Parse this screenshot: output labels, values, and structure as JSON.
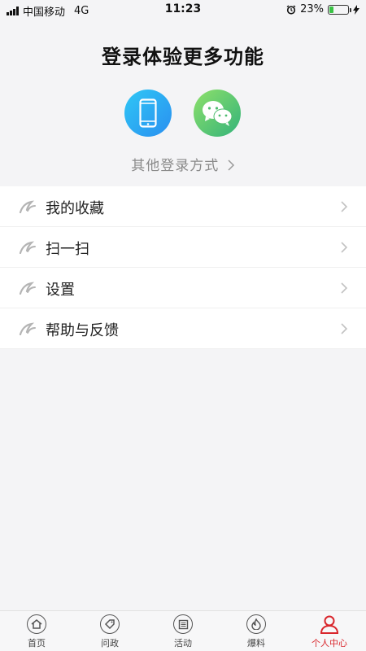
{
  "status_bar": {
    "carrier": "中国移动",
    "network": "4G",
    "time": "11:23",
    "battery": "23%"
  },
  "login": {
    "title": "登录体验更多功能",
    "phone_icon": "phone-icon",
    "wechat_icon": "wechat-icon",
    "other_methods": "其他登录方式"
  },
  "menu": {
    "items": [
      {
        "label": "我的收藏",
        "icon": "ribbon-icon"
      },
      {
        "label": "扫一扫",
        "icon": "ribbon-icon"
      },
      {
        "label": "设置",
        "icon": "ribbon-icon"
      },
      {
        "label": "帮助与反馈",
        "icon": "ribbon-icon"
      }
    ]
  },
  "tabbar": {
    "tabs": [
      {
        "label": "首页",
        "icon": "home-icon"
      },
      {
        "label": "问政",
        "icon": "tag-icon"
      },
      {
        "label": "活动",
        "icon": "newspaper-icon"
      },
      {
        "label": "爆料",
        "icon": "fire-icon"
      },
      {
        "label": "个人中心",
        "icon": "person-icon",
        "active": true
      }
    ]
  },
  "colors": {
    "accent": "#d9262c",
    "background": "#f4f4f6",
    "phone_gradient": "#2a8ff0",
    "wechat_gradient": "#33b37a"
  }
}
